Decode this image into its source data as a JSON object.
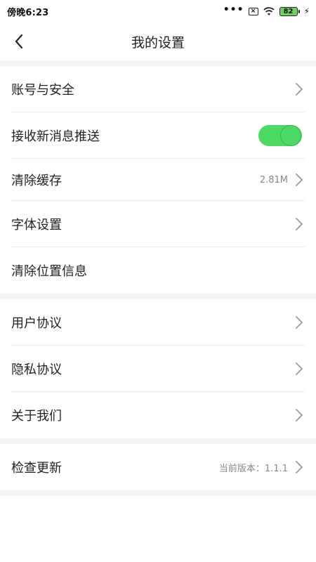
{
  "status": {
    "time": "傍晚6:23",
    "dots": "•••",
    "battery": "82"
  },
  "header": {
    "title": "我的设置"
  },
  "settings": {
    "account_security": "账号与安全",
    "push_notifications": "接收新消息推送",
    "push_enabled": true,
    "clear_cache": "清除缓存",
    "cache_size": "2.81M",
    "font_settings": "字体设置",
    "clear_location": "清除位置信息",
    "user_agreement": "用户协议",
    "privacy_agreement": "隐私协议",
    "about_us": "关于我们",
    "check_update": "检查更新",
    "current_version": "当前版本：1.1.1"
  },
  "colors": {
    "accent": "#4cd964",
    "section_bg": "#f5f5f5",
    "divider": "#ebebeb"
  },
  "icons": {
    "back": "chevron-left-icon",
    "row_arrow": "chevron-right-icon"
  }
}
